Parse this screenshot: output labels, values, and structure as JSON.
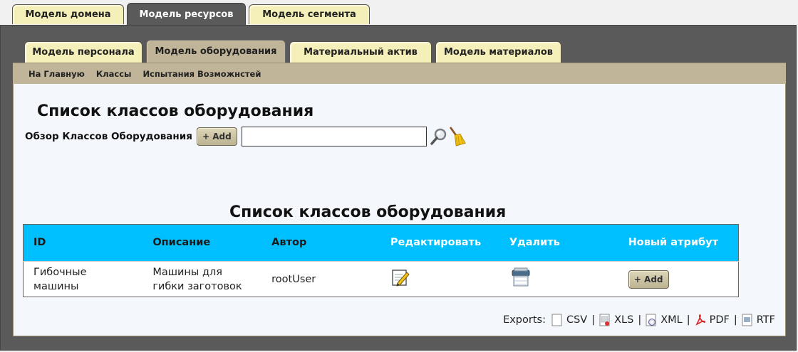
{
  "top_tabs": [
    {
      "label": "Модель домена",
      "active": false
    },
    {
      "label": "Модель ресурсов",
      "active": true
    },
    {
      "label": "Модель сегмента",
      "active": false
    }
  ],
  "sub_tabs": [
    {
      "label": "Модель персонала",
      "active": false
    },
    {
      "label": "Модель оборудования",
      "active": true
    },
    {
      "label": "Материальный актив",
      "active": false
    },
    {
      "label": "Модель материалов",
      "active": false
    }
  ],
  "nav": [
    "На Главную",
    "Классы",
    "Испытания Возможнстей"
  ],
  "page": {
    "title": "Список классов оборудования",
    "browse_label": "Обзор Классов Оборудования",
    "add_label": "+ Add",
    "search_value": "",
    "table_title": "Список классов оборудования"
  },
  "table": {
    "headers": [
      "ID",
      "Описание",
      "Автор",
      "Редактировать",
      "Удалить",
      "Новый атрибут"
    ],
    "rows": [
      {
        "id": "Гибочные машины",
        "description": "Машины для гибки заготовок",
        "author": "rootUser",
        "add_label": "+ Add"
      }
    ]
  },
  "exports": {
    "label": "Exports:",
    "items": [
      "CSV",
      "XLS",
      "XML",
      "PDF",
      "RTF"
    ]
  },
  "colors": {
    "header_bg": "#00bfff",
    "tab_bg": "#f5efb9",
    "nav_bg": "#c0b499",
    "frame": "#5a5a5a"
  }
}
